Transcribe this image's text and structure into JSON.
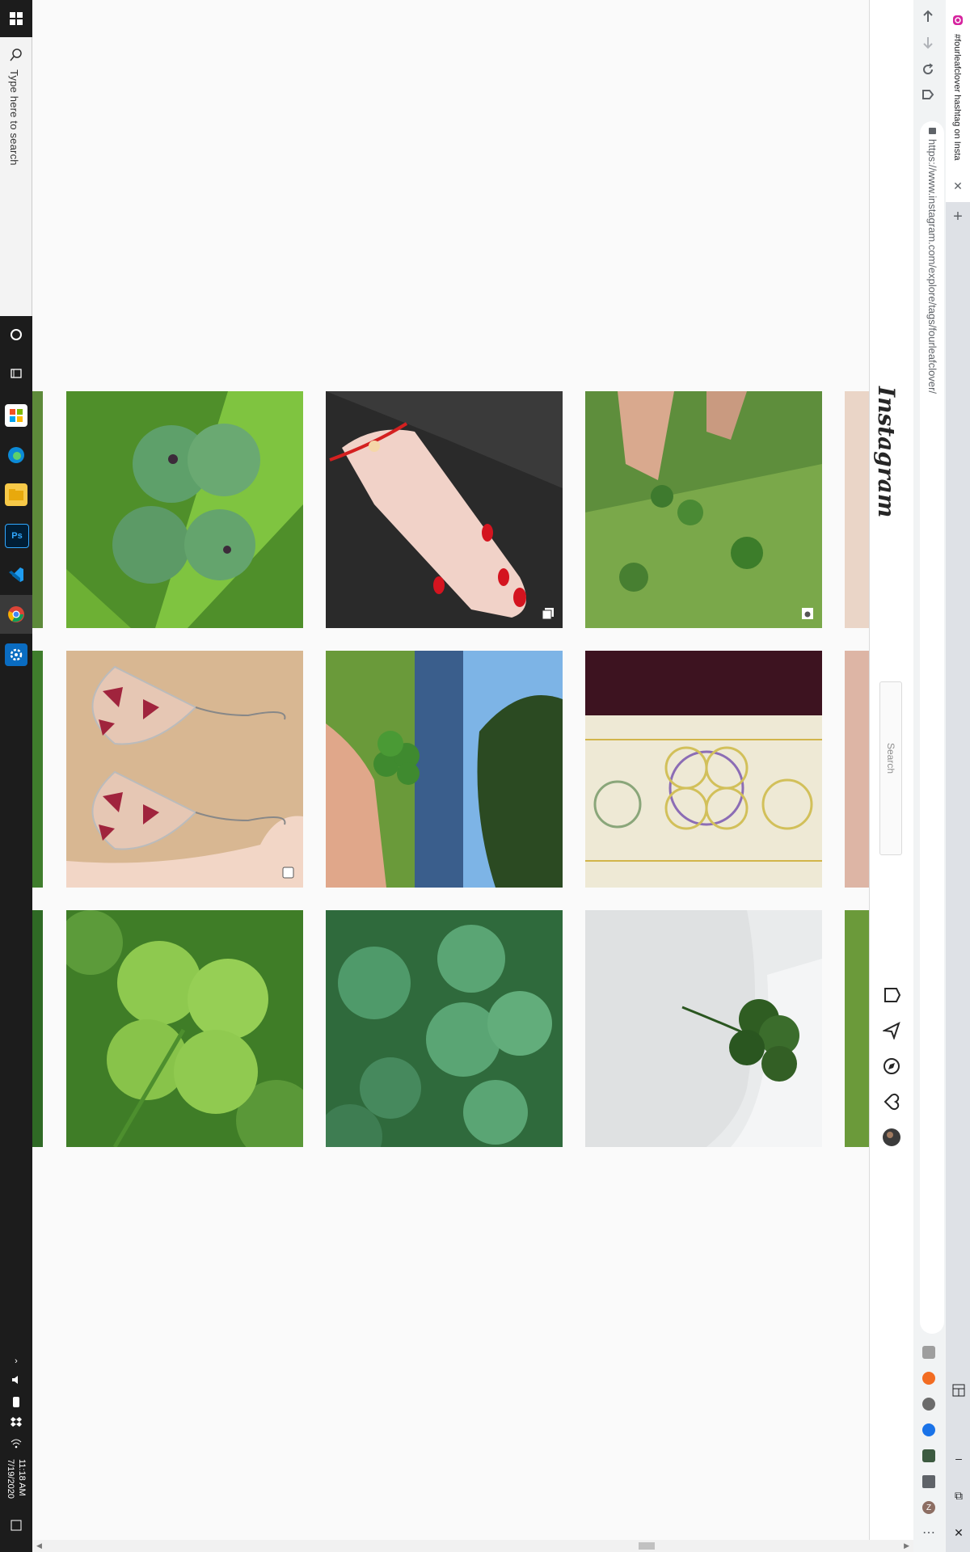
{
  "taskbar": {
    "search_placeholder": "Type here to search",
    "time": "11:18 AM",
    "date": "7/19/2020",
    "apps": [
      "task-view",
      "store",
      "edge",
      "file-explorer",
      "photoshop",
      "vscode",
      "chrome",
      "settings"
    ]
  },
  "browser": {
    "tab_title": "#fourleafclover hashtag on Insta",
    "url": "https://www.instagram.com/explore/tags/fourleafclover/",
    "extensions": [
      "grammarly",
      "honey",
      "dark-reader",
      "bitwarden",
      "tab-manager",
      "puzzle",
      "profile-z"
    ],
    "profile_initial": "Z"
  },
  "instagram": {
    "logo_text": "Instagram",
    "search_placeholder": "Search"
  },
  "grid": {
    "rows": [
      [
        "three-leaf clover",
        "red bracelet on hand",
        "hand picking clover in grass"
      ],
      [
        "pressed flower teardrop earrings",
        "hand holding four-leaf clover by lake",
        "clover drawing sketch"
      ],
      [
        "four-leaf clover close-up",
        "clover patch",
        "four-leaf clover in white dish"
      ]
    ]
  },
  "colors": {
    "taskbar_bg": "#1c1c1c",
    "page_bg": "#fafafa",
    "chrome_bg": "#f1f3f4"
  }
}
